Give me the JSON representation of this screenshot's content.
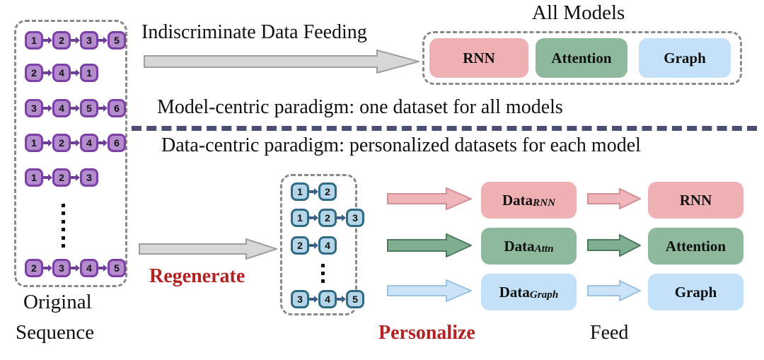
{
  "headings": {
    "all_models": "All Models",
    "indiscriminate": "Indiscriminate Data Feeding",
    "model_centric": "Model-centric paradigm: one dataset for all models",
    "data_centric": "Data-centric paradigm: personalized datasets for each model"
  },
  "left_panel": {
    "caption_line1": "Original",
    "caption_line2": "Sequence",
    "ellipsis_dots": 6,
    "sequences": [
      [
        "1",
        "2",
        "3",
        "5"
      ],
      [
        "2",
        "4",
        "1"
      ],
      [
        "3",
        "4",
        "5",
        "6"
      ],
      [
        "1",
        "2",
        "4",
        "6"
      ],
      [
        "1",
        "2",
        "3"
      ],
      [
        "2",
        "3",
        "4",
        "5"
      ]
    ]
  },
  "middle_panel": {
    "ellipsis_dots": 3,
    "sequences": [
      [
        "1",
        "2"
      ],
      [
        "1",
        "2",
        "3"
      ],
      [
        "2",
        "4"
      ],
      [
        "3",
        "4",
        "5"
      ]
    ]
  },
  "all_models_boxes": [
    {
      "label": "RNN",
      "color": "#f0b1b4"
    },
    {
      "label": "Attention",
      "color": "#8fb99d"
    },
    {
      "label": "Graph",
      "color": "#c3e1f8"
    }
  ],
  "data_boxes": [
    {
      "label": "Data",
      "subscript": "RNN",
      "color": "#f0b1b4"
    },
    {
      "label": "Data",
      "subscript": "Attn",
      "color": "#8fb99d"
    },
    {
      "label": "Data",
      "subscript": "Graph",
      "color": "#c3e1f8"
    }
  ],
  "model_boxes": [
    {
      "label": "RNN",
      "color": "#f0b1b4"
    },
    {
      "label": "Attention",
      "color": "#8fb99d"
    },
    {
      "label": "Graph",
      "color": "#c3e1f8"
    }
  ],
  "process_labels": {
    "regenerate": "Regenerate",
    "personalize": "Personalize",
    "feed": "Feed"
  },
  "colors": {
    "node_purple_fill": "#b48ccd",
    "node_purple_border": "#7b3fa5",
    "node_blue_fill": "#b4d6e8",
    "node_blue_border": "#2f6b82",
    "gray_arrow": "#d4d4d4",
    "gray_arrow_border": "#9a9a9a",
    "dashed_border": "#8a8a8a",
    "divider": "#4a4f73",
    "accent_red": "#b22222",
    "pink": "#f0b1b4",
    "pink_border": "#d98f95",
    "green": "#8fb99d",
    "green_border": "#5c8a6c",
    "blue": "#c3e1f8",
    "blue_border": "#9cc2e0"
  }
}
